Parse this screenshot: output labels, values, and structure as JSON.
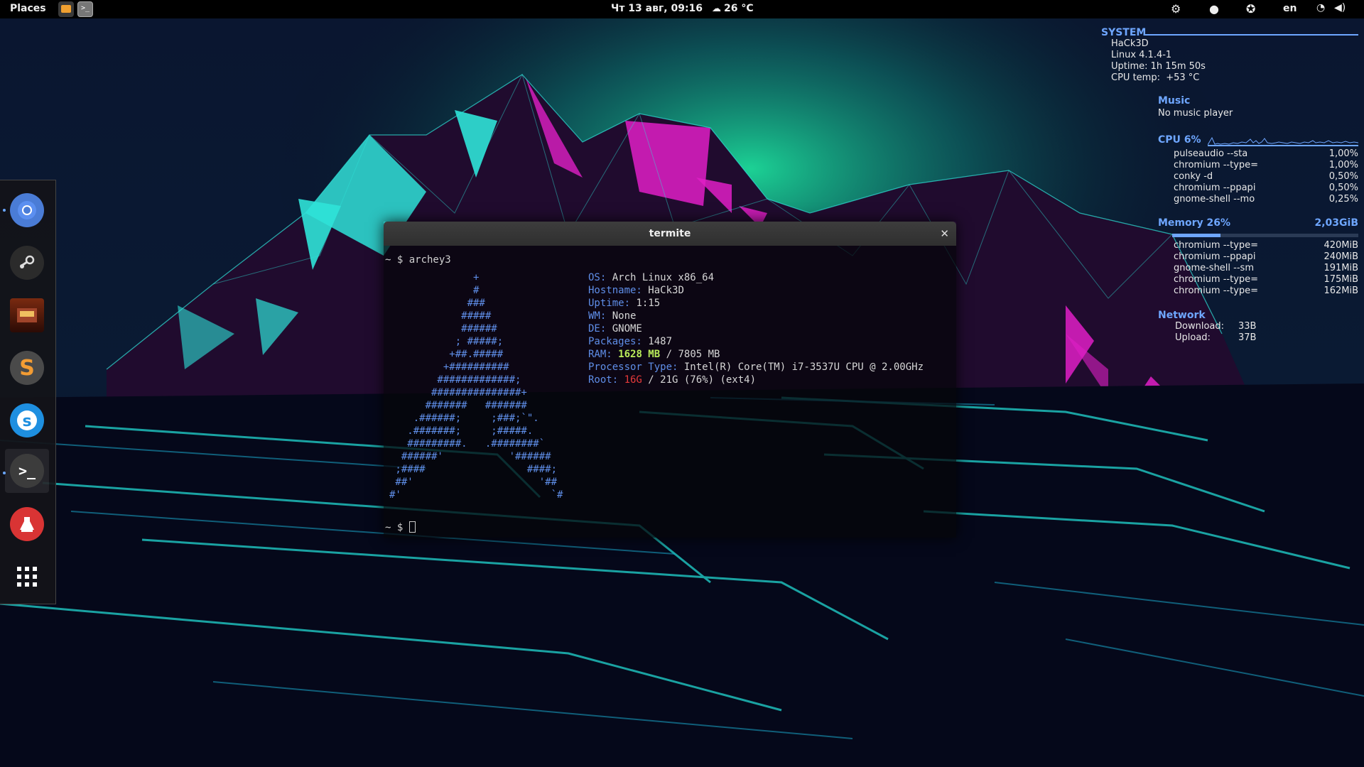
{
  "topbar": {
    "places": "Places",
    "clock": "Чт 13 авг, 09:16",
    "weather": "26 °C",
    "language": "en",
    "status_icons": [
      "settings-icon",
      "steam-tray-icon",
      "accessibility-icon",
      "wifi-icon",
      "volume-icon"
    ]
  },
  "dock": {
    "apps": [
      "chromium",
      "steam",
      "path-of-exile",
      "sublime-text",
      "skype",
      "terminal",
      "test-app",
      "show-applications"
    ]
  },
  "terminal": {
    "title": "termite",
    "command_prompt": "~ $ archey3",
    "final_prompt": "~ $ ",
    "logo": [
      "              +",
      "              #",
      "             ###",
      "            #####",
      "            ######",
      "           ; #####;",
      "          +##.#####",
      "         +##########",
      "        #############;",
      "       ###############+",
      "      #######   #######",
      "    .######;     ;###;`\".",
      "   .#######;     ;#####.",
      "   #########.   .########`",
      "  ######'           '######",
      " ;####                 ####;",
      " ##'                     '##",
      "#'                         `#"
    ],
    "info": [
      {
        "key": "OS: ",
        "value": "Arch Linux x86_64"
      },
      {
        "key": "Hostname: ",
        "value": "HaCk3D"
      },
      {
        "key": "Uptime: ",
        "value": "1:15"
      },
      {
        "key": "WM: ",
        "value": "None"
      },
      {
        "key": "DE: ",
        "value": "GNOME"
      },
      {
        "key": "Packages: ",
        "value": "1487"
      },
      {
        "key": "RAM: ",
        "value_highlight": "1628 MB",
        "value": " / 7805 MB"
      },
      {
        "key": "Processor Type: ",
        "value": "Intel(R) Core(TM) i7-3537U CPU @ 2.00GHz"
      },
      {
        "key": "Root: ",
        "value_alert": "16G",
        "value": " / 21G (76%) (ext4)"
      }
    ]
  },
  "conky": {
    "system": {
      "heading": "SYSTEM",
      "hostname": "HaCk3D",
      "kernel": "Linux 4.1.4-1",
      "uptime": "Uptime: 1h 15m 50s",
      "cpu_temp": "CPU temp:  +53 °C"
    },
    "music": {
      "heading": "Music",
      "status": "No music player"
    },
    "cpu": {
      "heading": "CPU 6%",
      "usage_fraction": 0.06,
      "processes": [
        {
          "name": "pulseaudio --sta",
          "value": "1,00%"
        },
        {
          "name": "chromium --type=",
          "value": "1,00%"
        },
        {
          "name": "conky -d",
          "value": "0,50%"
        },
        {
          "name": "chromium --ppapi",
          "value": "0,50%"
        },
        {
          "name": "gnome-shell --mo",
          "value": "0,25%"
        }
      ]
    },
    "memory": {
      "heading": "Memory 26%",
      "total": "2,03GiB",
      "usage_fraction": 0.26,
      "processes": [
        {
          "name": "chromium --type=",
          "value": "420MiB"
        },
        {
          "name": "chromium --ppapi",
          "value": "240MiB"
        },
        {
          "name": "gnome-shell --sm",
          "value": "191MiB"
        },
        {
          "name": "chromium --type=",
          "value": "175MiB"
        },
        {
          "name": "chromium --type=",
          "value": "162MiB"
        }
      ]
    },
    "network": {
      "heading": "Network",
      "download_label": "Download:",
      "download_value": "33B",
      "upload_label": "Upload:",
      "upload_value": "37B"
    }
  },
  "colors": {
    "accent": "#6ea6ff",
    "neon_cyan": "#2fe3d8",
    "neon_magenta": "#e01fc6",
    "terminal_key": "#5f8ee8",
    "ram_highlight": "#b9ec5a",
    "root_alert": "#e63a3a"
  }
}
